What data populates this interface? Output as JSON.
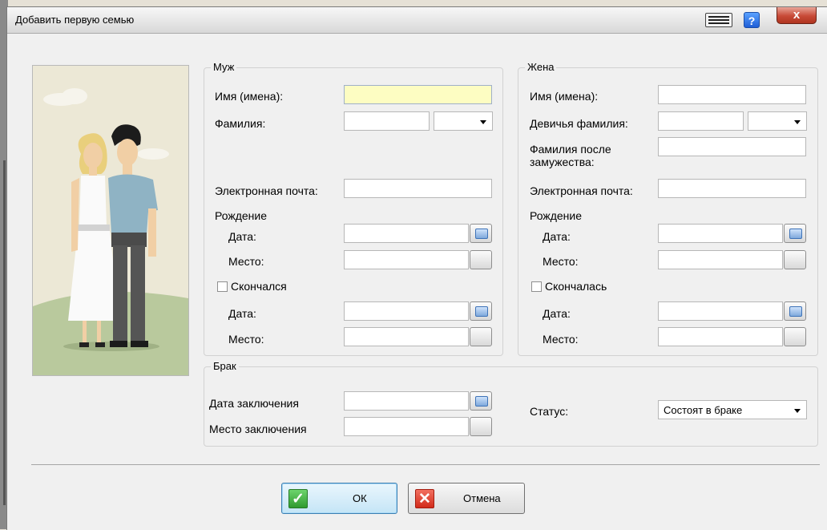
{
  "window": {
    "title": "Добавить первую семью",
    "close_label": "x",
    "help_label": "?"
  },
  "husband": {
    "group_title": "Муж",
    "given_names_label": "Имя (имена):",
    "surname_label": "Фамилия:",
    "email_label": "Электронная почта:",
    "birth_label": "Рождение",
    "birth_date_label": "Дата:",
    "birth_place_label": "Место:",
    "deceased_label": "Скончался",
    "death_date_label": "Дата:",
    "death_place_label": "Место:"
  },
  "wife": {
    "group_title": "Жена",
    "given_names_label": "Имя (имена):",
    "maiden_name_label": "Девичья фамилия:",
    "married_name_label_1": "Фамилия после",
    "married_name_label_2": "замужества:",
    "email_label": "Электронная почта:",
    "birth_label": "Рождение",
    "birth_date_label": "Дата:",
    "birth_place_label": "Место:",
    "deceased_label": "Скончалась",
    "death_date_label": "Дата:",
    "death_place_label": "Место:"
  },
  "marriage": {
    "group_title": "Брак",
    "date_label": "Дата заключения",
    "place_label": "Место заключения",
    "status_label": "Статус:",
    "status_value": "Состоят в браке"
  },
  "buttons": {
    "ok_label": "ОК",
    "cancel_label": "Отмена"
  },
  "icons": {
    "keyboard": "keyboard-icon",
    "help": "help-icon",
    "close": "close-icon",
    "calendar": "calendar-icon",
    "ok": "checkmark-icon",
    "cancel": "x-icon"
  },
  "colors": {
    "highlight_field": "#fdfdc2",
    "ok_green": "#2f9a2f",
    "cancel_red": "#d22b1a",
    "close_red": "#c74a37"
  }
}
